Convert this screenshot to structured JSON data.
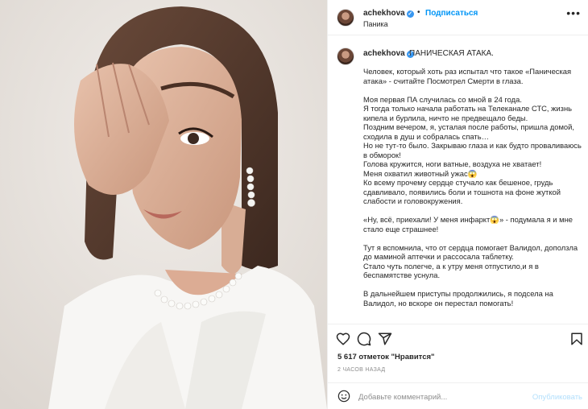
{
  "post": {
    "username": "achekhova",
    "follow_label": "Подписаться",
    "location": "Паника",
    "title": "ПАНИЧЕСКАЯ АТАКА.",
    "caption": "Человек, который хоть раз испытал что такое «Паническая атака» - считайте Посмотрел Смерти в глаза.\n\nМоя первая ПА случилась со мной в 24 года.\nЯ тогда только начала работать на Телеканале СТС, жизнь кипела и бурлила, ничто не предвещало беды.\nПоздним вечером, я, усталая после работы, пришла домой, сходила в душ и собралась спать…\nНо не тут-то было. Закрываю глаза и как будто проваливаюсь в обморок!\nГолова кружится, ноги ватные, воздуха не хватает!\nМеня охватил животный ужас😱\nКо всему прочему сердце стучало как бешеное, грудь сдавливало, появились боли и тошнота на фоне жуткой слабости и головокружения.\n\n«Ну, всё, приехали! У меня инфаркт😱» - подумала я и мне стало еще страшнее!\n\nТут я вспомнила, что от сердца помогает Валидол, доползла до маминой аптечки и рассосала таблетку.\nСтало чуть полегче, а к утру меня отпустило,и я в беспамятстве уснула.\n\nВ дальнейшем приступы продолжились, я подсела на Валидол, но вскоре он перестал помогать!",
    "likes": "5 617 отметок \"Нравится\"",
    "time": "2 ЧАСОВ НАЗАД"
  },
  "comment": {
    "placeholder": "Добавьте комментарий...",
    "publish_label": "Опубликовать"
  },
  "colors": {
    "accent": "#0095f6",
    "publish_disabled": "#b2dffc",
    "verified": "#3897f0"
  },
  "icons": [
    "heart-icon",
    "comment-icon",
    "share-icon",
    "bookmark-icon",
    "emoji-icon",
    "more-icon",
    "verified-icon"
  ]
}
